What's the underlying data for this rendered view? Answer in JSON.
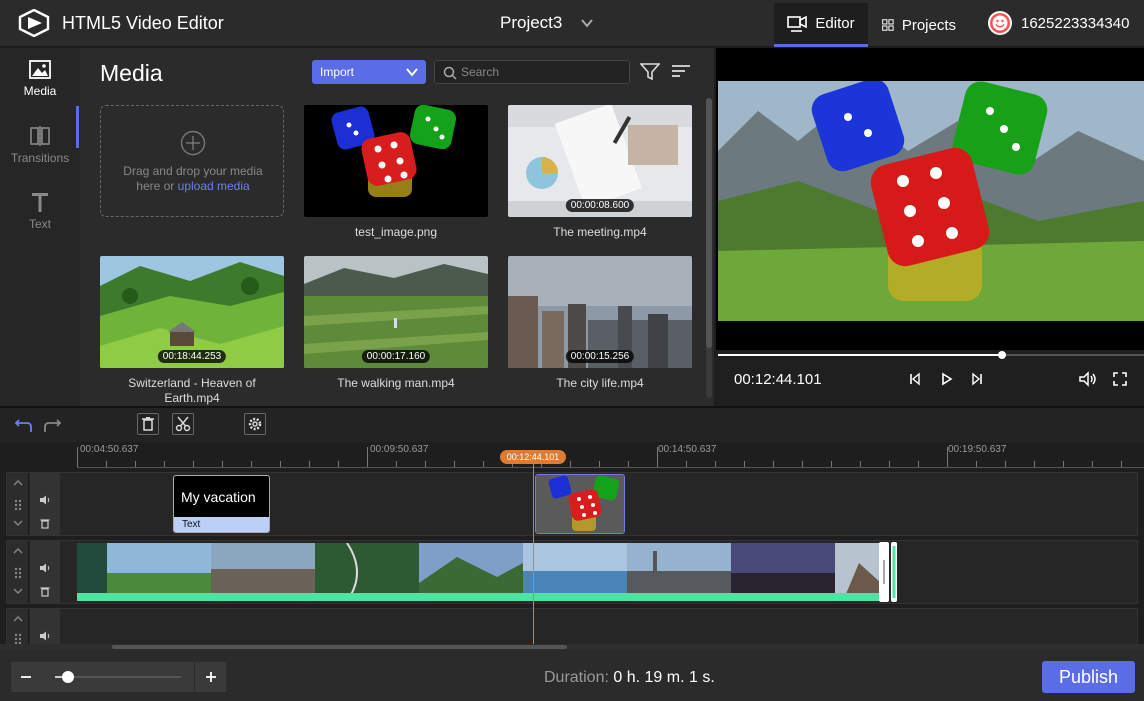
{
  "header": {
    "app_title": "HTML5 Video Editor",
    "project_name": "Project3",
    "tabs": [
      {
        "label": "Editor",
        "icon": "video-camera-icon",
        "active": true
      },
      {
        "label": "Projects",
        "icon": "grid-icon",
        "active": false
      }
    ],
    "user_id": "1625223334340"
  },
  "nav": {
    "items": [
      {
        "label": "Media",
        "icon": "image-icon",
        "active": true
      },
      {
        "label": "Transitions",
        "icon": "transition-icon",
        "active": false
      },
      {
        "label": "Text",
        "icon": "text-icon",
        "active": false
      }
    ]
  },
  "media": {
    "title": "Media",
    "import_label": "Import",
    "search_placeholder": "Search",
    "drop_text_1": "Drag and drop your media",
    "drop_text_2": "here or ",
    "upload_link": "upload media",
    "items": [
      {
        "label": "test_image.png",
        "duration": ""
      },
      {
        "label": "The meeting.mp4",
        "duration": "00:00:08.600"
      },
      {
        "label": "Switzerland - Heaven of Earth.mp4",
        "duration": "00:18:44.253"
      },
      {
        "label": "The walking man.mp4",
        "duration": "00:00:17.160"
      },
      {
        "label": "The city life.mp4",
        "duration": "00:00:15.256"
      }
    ]
  },
  "preview": {
    "current_time": "00:12:44.101",
    "progress_fraction": 0.667
  },
  "timeline": {
    "ruler_labels": [
      "00:04:50.637",
      "00:09:50.637",
      "00:14:50.637",
      "00:19:50.637"
    ],
    "playhead_time": "00:12:44.101",
    "text_clip": {
      "title": "My vacation",
      "tag": "Text"
    }
  },
  "footer": {
    "zoom_fraction": 0.1,
    "duration_label": "Duration:",
    "duration_value": "0 h. 19 m. 1 s.",
    "publish_label": "Publish"
  },
  "colors": {
    "accent": "#5b6de6",
    "playhead": "#e07b2f",
    "video_track": "#4ee3a3"
  }
}
